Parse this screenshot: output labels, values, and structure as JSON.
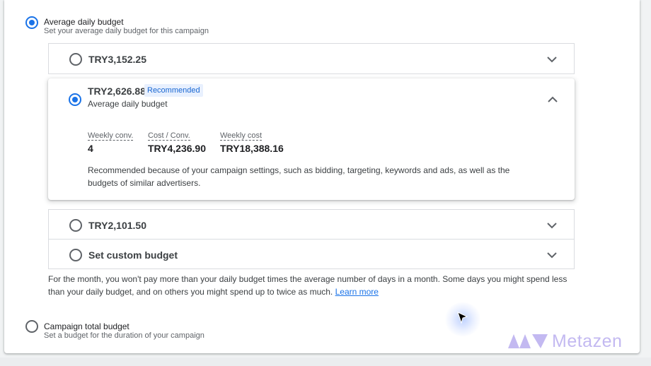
{
  "average_option": {
    "title": "Average daily budget",
    "subtitle": "Set your average daily budget for this campaign",
    "selected": true
  },
  "budget_options": [
    {
      "amount": "TRY3,152.25",
      "selected": false,
      "expanded": false
    },
    {
      "amount": "TRY2,626.88",
      "badge": "Recommended",
      "subtitle": "Average daily budget",
      "selected": true,
      "expanded": true,
      "metrics": [
        {
          "label": "Weekly conv.",
          "value": "4"
        },
        {
          "label": "Cost / Conv.",
          "value": "TRY4,236.90"
        },
        {
          "label": "Weekly cost",
          "value": "TRY18,388.16"
        }
      ],
      "explanation": "Recommended because of your campaign settings, such as bidding, targeting, keywords and ads, as well as the budgets of similar advertisers."
    },
    {
      "amount": "TRY2,101.50",
      "selected": false,
      "expanded": false
    },
    {
      "amount": "Set custom budget",
      "selected": false,
      "expanded": false
    }
  ],
  "note": {
    "text": "For the month, you won't pay more than your daily budget times the average number of days in a month. Some days you might spend less than your daily budget, and on others you might spend up to twice as much. ",
    "link": "Learn more"
  },
  "total_option": {
    "title": "Campaign total budget",
    "subtitle": "Set a budget for the duration of your campaign",
    "selected": false
  },
  "watermark": {
    "text": "Metazen"
  },
  "colors": {
    "accent": "#1a73e8",
    "badge_bg": "#e8f0fe",
    "watermark": "#c3b9f1"
  }
}
